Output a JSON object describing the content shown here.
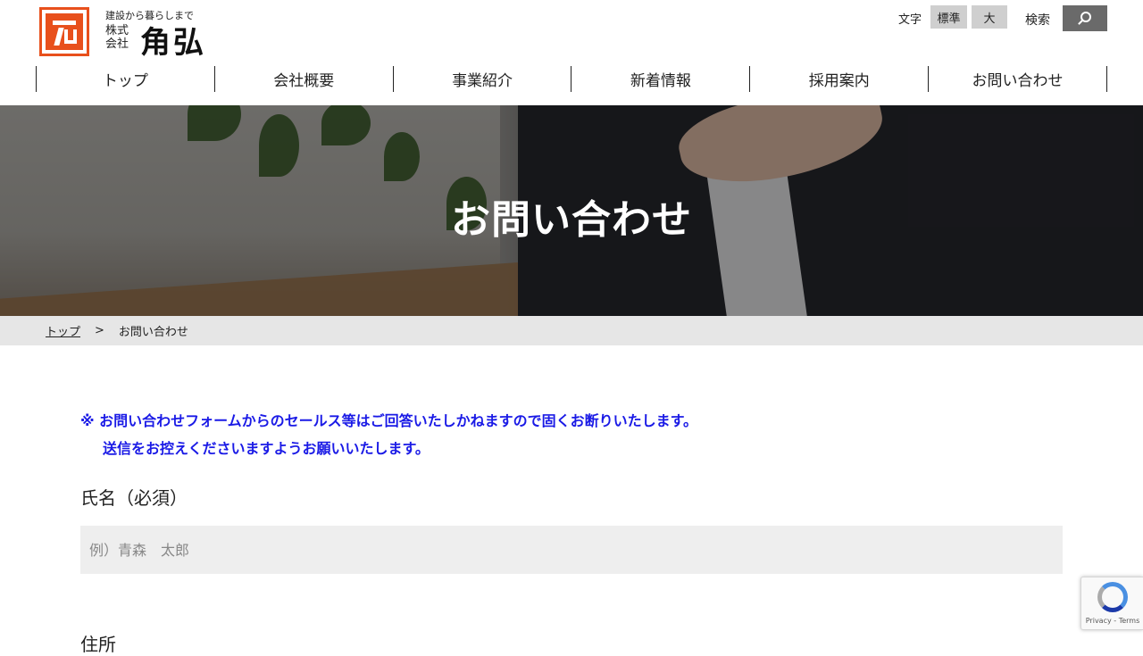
{
  "header": {
    "tagline": "建設から暮らしまで",
    "company_type": "株式会社",
    "company_name": "角弘",
    "font_size_label": "文字",
    "font_standard": "標準",
    "font_large": "大",
    "search_label": "検索",
    "accent_color": "#e8501c"
  },
  "nav": {
    "items": [
      {
        "label": "トップ"
      },
      {
        "label": "会社概要"
      },
      {
        "label": "事業紹介"
      },
      {
        "label": "新着情報"
      },
      {
        "label": "採用案内"
      },
      {
        "label": "お問い合わせ"
      }
    ]
  },
  "hero": {
    "title": "お問い合わせ"
  },
  "breadcrumb": {
    "home": "トップ",
    "separator": ">",
    "current": "お問い合わせ"
  },
  "notice": {
    "line1": "※ お問い合わせフォームからのセールス等はご回答いたしかねますので固くお断りいたします。",
    "line2": "送信をお控えくださいますようお願いいたします。",
    "color": "#1a1ae6"
  },
  "form": {
    "name_label": "氏名（必須）",
    "name_placeholder": "例）青森　太郎",
    "next_label": "住所"
  },
  "recaptcha": {
    "links": "Privacy - Terms"
  }
}
